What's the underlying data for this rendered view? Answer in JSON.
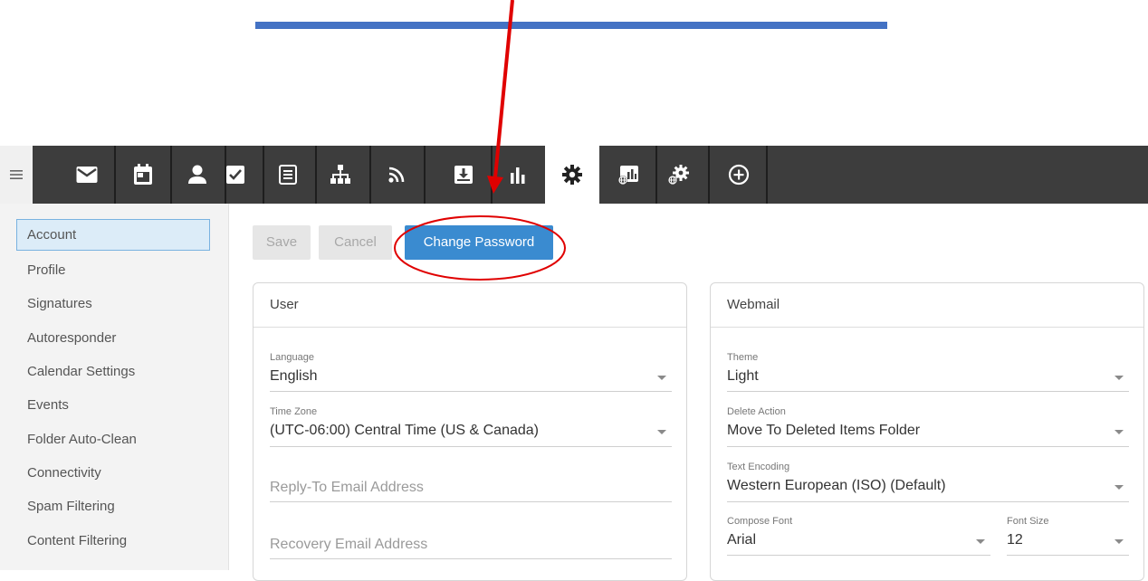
{
  "colors": {
    "nav_bg": "#3d3d3d",
    "accent": "#3a8bd0",
    "annotation_blue": "#4472c4",
    "annotation_red": "#e00000"
  },
  "nav": {
    "menu_icon": "hamburger-icon",
    "items": [
      {
        "icon": "mail-icon"
      },
      {
        "icon": "calendar-icon"
      },
      {
        "icon": "contacts-icon"
      },
      {
        "icon": "tasks-icon"
      },
      {
        "icon": "notes-icon"
      },
      {
        "icon": "file-tree-icon"
      },
      {
        "icon": "rss-icon"
      },
      {
        "icon": "inbox-download-icon"
      },
      {
        "icon": "reports-icon"
      },
      {
        "icon": "settings-gear-icon",
        "active": true
      },
      {
        "icon": "domain-reports-icon"
      },
      {
        "icon": "domain-settings-icon"
      },
      {
        "icon": "add-circle-icon"
      }
    ]
  },
  "sidebar": {
    "items": [
      {
        "label": "Account",
        "active": true
      },
      {
        "label": "Profile"
      },
      {
        "label": "Signatures"
      },
      {
        "label": "Autoresponder"
      },
      {
        "label": "Calendar Settings"
      },
      {
        "label": "Events"
      },
      {
        "label": "Folder Auto-Clean"
      },
      {
        "label": "Connectivity"
      },
      {
        "label": "Spam Filtering"
      },
      {
        "label": "Content Filtering"
      }
    ]
  },
  "toolbar": {
    "save_label": "Save",
    "cancel_label": "Cancel",
    "change_password_label": "Change Password"
  },
  "user_card": {
    "title": "User",
    "language": {
      "label": "Language",
      "value": "English"
    },
    "time_zone": {
      "label": "Time Zone",
      "value": "(UTC-06:00) Central Time (US & Canada)"
    },
    "reply_to": {
      "placeholder": "Reply-To Email Address"
    },
    "recovery": {
      "placeholder": "Recovery Email Address"
    }
  },
  "webmail_card": {
    "title": "Webmail",
    "theme": {
      "label": "Theme",
      "value": "Light"
    },
    "delete_action": {
      "label": "Delete Action",
      "value": "Move To Deleted Items Folder"
    },
    "text_encoding": {
      "label": "Text Encoding",
      "value": "Western European (ISO) (Default)"
    },
    "compose_font": {
      "label": "Compose Font",
      "value": "Arial"
    },
    "font_size": {
      "label": "Font Size",
      "value": "12"
    }
  }
}
